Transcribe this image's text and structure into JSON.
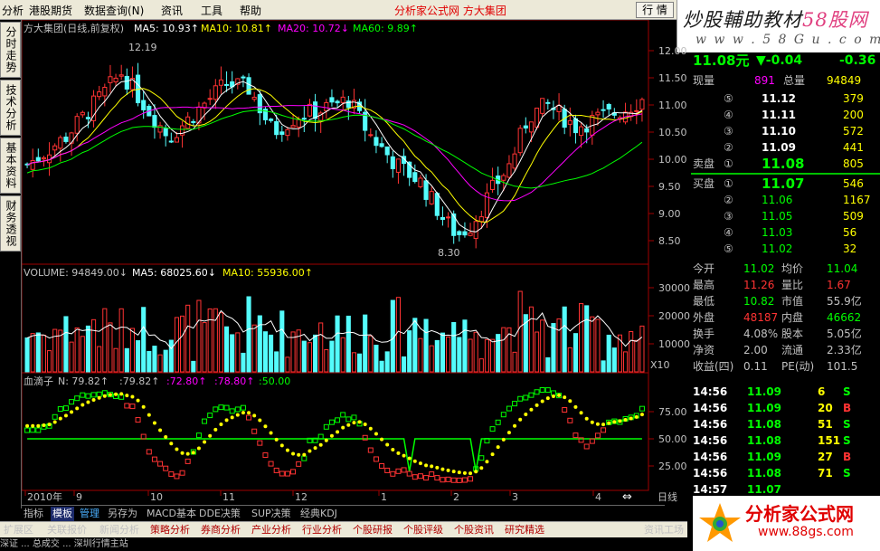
{
  "menubar": {
    "items": [
      "分析",
      "港股期货",
      "数据查询(N)",
      "资讯",
      "工具",
      "帮助"
    ],
    "brand": "分析家公式网 方大集团",
    "quote_button": "行 情"
  },
  "logo_top": {
    "text_main": "炒股輔助教材",
    "text_site": "58股网",
    "url": "w w w . 5 8 G u . c o m"
  },
  "left_tabs": [
    "分时走势",
    "技术分析",
    "基本资料",
    "财务透视"
  ],
  "main_chart": {
    "title": "方大集团(日线,前复权)",
    "ma": [
      {
        "label": "MA5: 10.93↑",
        "color": "#ffffff"
      },
      {
        "label": "MA10: 10.81↑",
        "color": "#ffff00"
      },
      {
        "label": "MA20: 10.72↓",
        "color": "#ff00ff"
      },
      {
        "label": "MA60: 9.89↑",
        "color": "#00ff00"
      }
    ],
    "high_mark": "12.19",
    "low_mark": "8.30",
    "yticks": [
      "12.00",
      "11.50",
      "11.00",
      "10.50",
      "10.00",
      "9.50",
      "9.00",
      "8.50"
    ],
    "xlabels": [
      "2010年",
      "9",
      "10",
      "11",
      "12",
      "1",
      "2",
      "3",
      "4"
    ],
    "x_units": "日线",
    "colors": {
      "up": "#ff3333",
      "down": "#54fcfc",
      "ma5": "#ffffff",
      "ma10": "#ffff00",
      "ma20": "#ff00ff",
      "ma60": "#00ff00"
    }
  },
  "volume_panel": {
    "title": "VOLUME: 94849.00↓",
    "ma5": "MA5: 68025.60↓",
    "ma10": "MA10: 55936.00↑",
    "yticks": [
      "30000",
      "20000",
      "10000"
    ],
    "x_label": "X10"
  },
  "indicator_panel": {
    "title": "血滴子",
    "n": "N: 79.82↑",
    "v2": ":79.82↑",
    "v3": ":72.80↑",
    "v4": ":78.80↑",
    "v5": ":50.00",
    "yticks": [
      "75.00",
      "50.00",
      "25.00"
    ]
  },
  "quote": {
    "price": "11.08元",
    "change": "▼-0.04",
    "pct": "-0.36",
    "xianliang_label": "现量",
    "xianliang": "891",
    "zongliang_label": "总量",
    "zongliang": "94849",
    "sell": [
      {
        "lv": "⑤",
        "p": "11.12",
        "v": "379"
      },
      {
        "lv": "④",
        "p": "11.11",
        "v": "200"
      },
      {
        "lv": "③",
        "p": "11.10",
        "v": "572"
      },
      {
        "lv": "②",
        "p": "11.09",
        "v": "441"
      },
      {
        "lv": "①",
        "p": "11.08",
        "v": "805"
      }
    ],
    "sell_label": "卖盘",
    "buy_label": "买盘",
    "buy": [
      {
        "lv": "①",
        "p": "11.07",
        "v": "546"
      },
      {
        "lv": "②",
        "p": "11.06",
        "v": "1167"
      },
      {
        "lv": "③",
        "p": "11.05",
        "v": "509"
      },
      {
        "lv": "④",
        "p": "11.03",
        "v": "56"
      },
      {
        "lv": "⑤",
        "p": "11.02",
        "v": "32"
      }
    ],
    "stats": [
      {
        "l1": "今开",
        "v1": "11.02",
        "l2": "均价",
        "v2": "11.04"
      },
      {
        "l1": "最高",
        "v1": "11.26",
        "l2": "量比",
        "v2": "1.67"
      },
      {
        "l1": "最低",
        "v1": "10.82",
        "l2": "市值",
        "v2": "55.9亿"
      },
      {
        "l1": "外盘",
        "v1": "48187",
        "l2": "内盘",
        "v2": "46662"
      },
      {
        "l1": "换手",
        "v1": "4.08%",
        "l2": "股本",
        "v2": "5.05亿"
      },
      {
        "l1": "净资",
        "v1": "2.00",
        "l2": "流通",
        "v2": "2.33亿"
      },
      {
        "l1": "收益(四)",
        "v1": "0.11",
        "l2": "PE(动)",
        "v2": "101.5"
      }
    ],
    "ticks": [
      {
        "t": "14:56",
        "p": "11.09",
        "v": "6",
        "s": "S"
      },
      {
        "t": "14:56",
        "p": "11.09",
        "v": "20",
        "s": "B"
      },
      {
        "t": "14:56",
        "p": "11.08",
        "v": "51",
        "s": "S"
      },
      {
        "t": "14:56",
        "p": "11.08",
        "v": "151",
        "s": "S"
      },
      {
        "t": "14:56",
        "p": "11.09",
        "v": "27",
        "s": "B"
      },
      {
        "t": "14:56",
        "p": "11.08",
        "v": "71",
        "s": "S"
      },
      {
        "t": "14:57",
        "p": "11.07",
        "v": "",
        "s": ""
      }
    ]
  },
  "bottom_tabs": [
    "指标",
    "模板",
    "管理",
    "另存为",
    "MACD基本",
    "DDE决策",
    "SUP决策",
    "经典KDJ"
  ],
  "nav": [
    "扩展区",
    "关联报价",
    "新闻分析",
    "策略分析",
    "券商分析",
    "产业分析",
    "行业分析",
    "个股研报",
    "个股评级",
    "个股资讯",
    "研究精选",
    "资讯工场"
  ],
  "status": "深证 ... 总成交 ... 深圳行情主站",
  "logo_bottom": {
    "t1": "分析家公式网",
    "t2": "www.88gs.com"
  }
}
